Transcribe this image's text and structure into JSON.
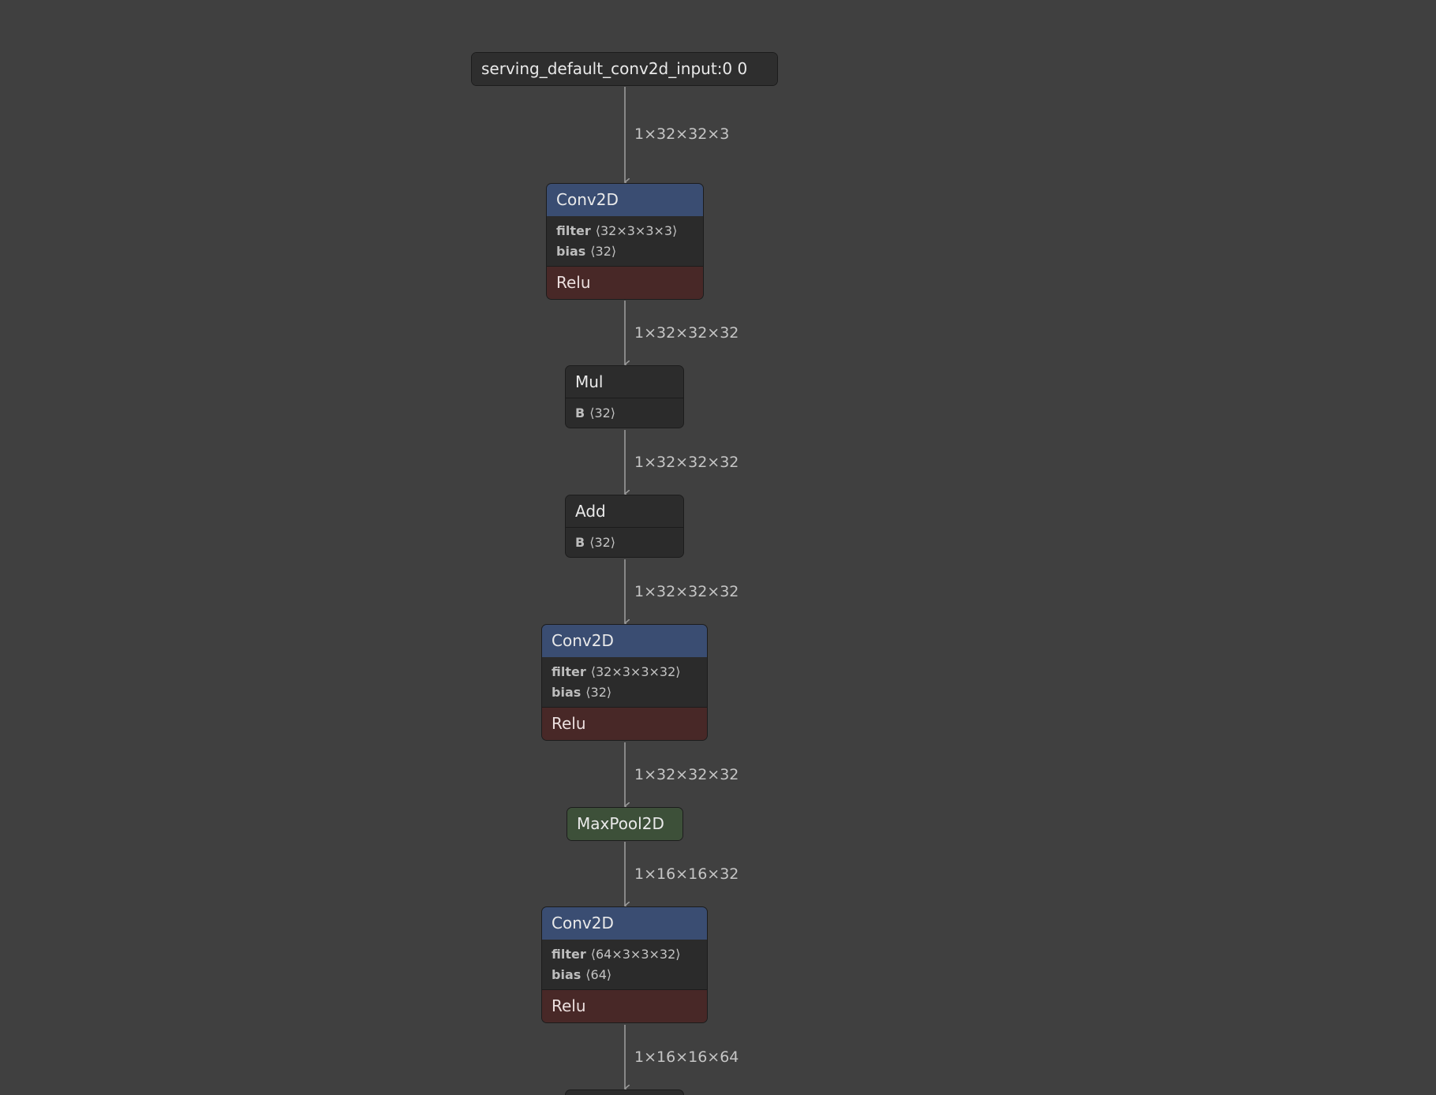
{
  "graph": {
    "input": {
      "label": "serving_default_conv2d_input:0 0"
    },
    "conv1": {
      "title": "Conv2D",
      "attrs": [
        {
          "name": "filter",
          "value": "⟨32×3×3×3⟩"
        },
        {
          "name": "bias",
          "value": "⟨32⟩"
        }
      ],
      "activation": "Relu"
    },
    "mul": {
      "title": "Mul",
      "attrs": [
        {
          "name": "B",
          "value": "⟨32⟩"
        }
      ]
    },
    "add": {
      "title": "Add",
      "attrs": [
        {
          "name": "B",
          "value": "⟨32⟩"
        }
      ]
    },
    "conv2": {
      "title": "Conv2D",
      "attrs": [
        {
          "name": "filter",
          "value": "⟨32×3×3×32⟩"
        },
        {
          "name": "bias",
          "value": "⟨32⟩"
        }
      ],
      "activation": "Relu"
    },
    "maxpool": {
      "title": "MaxPool2D"
    },
    "conv3": {
      "title": "Conv2D",
      "attrs": [
        {
          "name": "filter",
          "value": "⟨64×3×3×32⟩"
        },
        {
          "name": "bias",
          "value": "⟨64⟩"
        }
      ],
      "activation": "Relu"
    },
    "edges": [
      {
        "label": "1×32×32×3"
      },
      {
        "label": "1×32×32×32"
      },
      {
        "label": "1×32×32×32"
      },
      {
        "label": "1×32×32×32"
      },
      {
        "label": "1×32×32×32"
      },
      {
        "label": "1×16×16×32"
      },
      {
        "label": "1×16×16×64"
      }
    ]
  },
  "colors": {
    "background": "#404040",
    "conv_header": "#3a4d72",
    "activation": "#482827",
    "pool": "#3d5039",
    "node_body": "#2c2c2c",
    "edge": "#9a9a9a"
  }
}
